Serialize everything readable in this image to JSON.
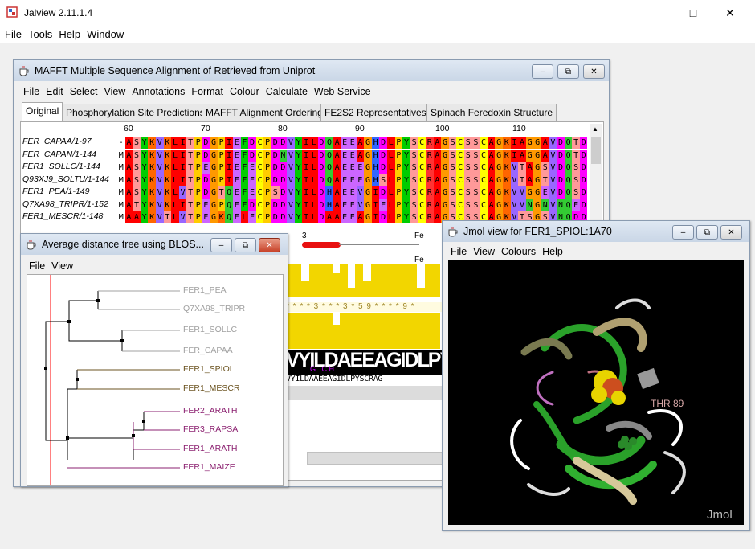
{
  "app": {
    "title": "Jalview 2.11.1.4",
    "menu": [
      "File",
      "Tools",
      "Help",
      "Window"
    ]
  },
  "alignment_window": {
    "title": "MAFFT Multiple Sequence Alignment of Retrieved from Uniprot",
    "menu": [
      "File",
      "Edit",
      "Select",
      "View",
      "Annotations",
      "Format",
      "Colour",
      "Calculate",
      "Web Service"
    ],
    "tabs": [
      "Original",
      "Phosphorylation Site Predictions",
      "MAFFT Alignment Ordering",
      "FE2S2 Representatives",
      "Spinach Feredoxin Structure"
    ],
    "ruler": [
      "60",
      "70",
      "80",
      "90",
      "100",
      "110"
    ],
    "sequences": [
      {
        "name": "FER_CAPAA/1-97",
        "residues": "-ASYKVKLITPDGPIEFDCPDDVYILDQAEEAGHDLPYSCRAGSCSSCAGKIAGGAVDQTD"
      },
      {
        "name": "FER_CAPAN/1-144",
        "residues": "MASYKVKLITPDGPIEFDCPDNVYILDQAEEAGHDLPYSCRAGSCSSCAGKIAGGAVDQTD"
      },
      {
        "name": "FER1_SOLLC/1-144",
        "residues": "MASYKVKLITPEGPIEFECPDDVYILDQAEEEGHDLPYSCRAGSCSSCAGKVTAGSVDQSD"
      },
      {
        "name": "Q93XJ9_SOLTU/1-144",
        "residues": "MASYKVKLITPDGPIEFECPDDVYILDQAEEEGHSLPYSCRAGSCSSCAGKVTAGTVDQSD"
      },
      {
        "name": "FER1_PEA/1-149",
        "residues": "MASYKVKLVTPDGTQEFECPSDVYILDHAEEVGIDLPYSCRAGSCSSCAGKVVGGEVDQSD"
      },
      {
        "name": "Q7XA98_TRIPR/1-152",
        "residues": "MATYKVKLITPEGPQEFDCPDDVYILDHAEEVGIELPYSCRAGSCSSCAGKVVNGNVNQED"
      },
      {
        "name": "FER1_MESCR/1-148",
        "residues": "MAAYKVTLVTPEGKQELECPDDVYILDAAEEAGIDLPYSCRAGSCSSCAGKVTSGSVNQDD"
      }
    ],
    "annotation_labels": [
      "3",
      "Fe",
      "Fe"
    ],
    "conservation_row": "* * * * 3 * * * 3 * 5 9 * * * * 9 *",
    "consensus_logo": "VYILDAEEAGIDLPYSCRA",
    "consensus_logo_sub": "G   C H",
    "consensus_text": "VYILDAAEEAGIDLPYSCRAG"
  },
  "tree_window": {
    "title": "Average distance tree using BLOS...",
    "menu": [
      "File",
      "View"
    ],
    "leaves": [
      {
        "name": "FER1_PEA",
        "color": "#a0a0a0"
      },
      {
        "name": "Q7XA98_TRIPR",
        "color": "#a0a0a0"
      },
      {
        "name": "FER1_SOLLC",
        "color": "#a0a0a0"
      },
      {
        "name": "FER_CAPAA",
        "color": "#a0a0a0"
      },
      {
        "name": "FER1_SPIOL",
        "color": "#6b5320"
      },
      {
        "name": "FER1_MESCR",
        "color": "#6b5320"
      },
      {
        "name": "FER2_ARATH",
        "color": "#8b2070"
      },
      {
        "name": "FER3_RAPSA",
        "color": "#8b2070"
      },
      {
        "name": "FER1_ARATH",
        "color": "#8b2070"
      },
      {
        "name": "FER1_MAIZE",
        "color": "#8b2070"
      }
    ]
  },
  "jmol_window": {
    "title": "Jmol view for FER1_SPIOL:1A70",
    "menu": [
      "File",
      "View",
      "Colours",
      "Help"
    ],
    "label": "THR 89",
    "watermark": "Jmol"
  },
  "colors": {
    "A": "#ff0000",
    "S": "#ff9999",
    "Y": "#00cc00",
    "K": "#ff6600",
    "V": "#9966ff",
    "L": "#ff0000",
    "I": "#ff0000",
    "T": "#ff9999",
    "P": "#ffcc00",
    "D": "#ff00ff",
    "G": "#ff9900",
    "E": "#cc66ff",
    "F": "#00cc00",
    "C": "#ffff00",
    "Q": "#33cc33",
    "H": "#3366ff",
    "R": "#ff3333",
    "N": "#33cc33",
    "M": "#ffffff",
    "-": "#ffffff"
  }
}
